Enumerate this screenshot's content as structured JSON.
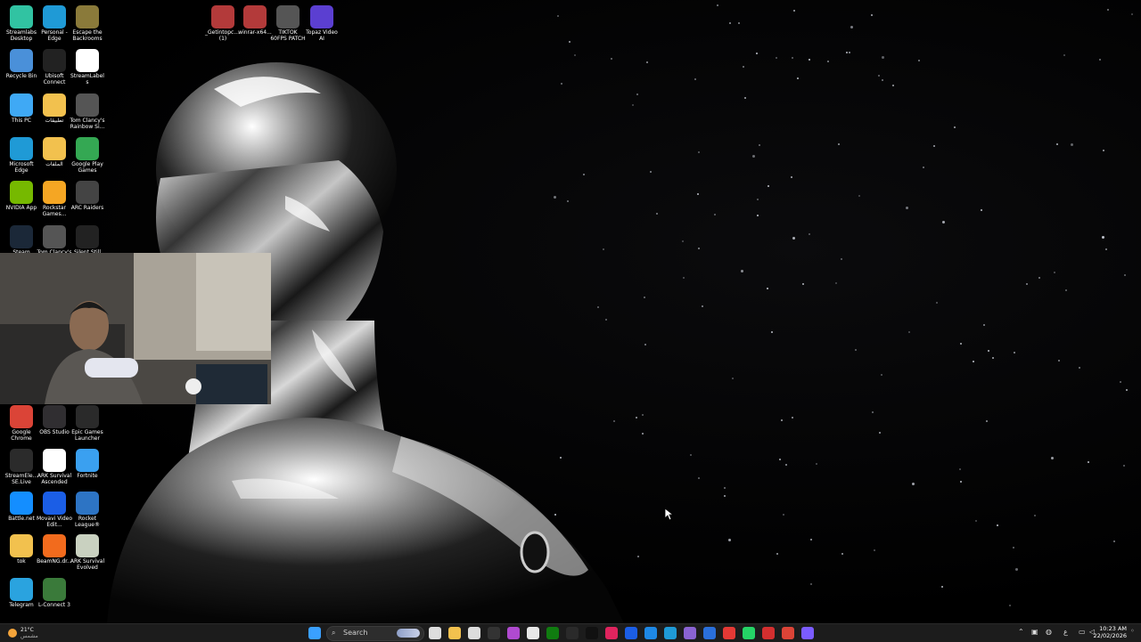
{
  "desktop_icons": [
    {
      "label": "Streamlabs Desktop",
      "icon": "streamlabs-icon",
      "color": "#31c3a2"
    },
    {
      "label": "Personal - Edge",
      "icon": "edge-icon",
      "color": "#1f9ad6"
    },
    {
      "label": "Escape the Backrooms",
      "icon": "game-icon",
      "color": "#8a7a3a"
    },
    {
      "label": "Recycle Bin",
      "icon": "recycle-bin-icon",
      "color": "#4a90d9"
    },
    {
      "label": "Ubisoft Connect",
      "icon": "ubisoft-icon",
      "color": "#222222"
    },
    {
      "label": "StreamLabels",
      "icon": "streamlabels-icon",
      "color": "#ffffff"
    },
    {
      "label": "This PC",
      "icon": "this-pc-icon",
      "color": "#3fa9f5"
    },
    {
      "label": "تطبيقات",
      "icon": "folder-icon",
      "color": "#f2c14e"
    },
    {
      "label": "Tom Clancy's Rainbow Si...",
      "icon": "game-icon",
      "color": "#555555"
    },
    {
      "label": "Microsoft Edge",
      "icon": "edge-icon",
      "color": "#1f9ad6"
    },
    {
      "label": "الملفات",
      "icon": "folder-icon",
      "color": "#f2c14e"
    },
    {
      "label": "Google Play Games",
      "icon": "play-games-icon",
      "color": "#34a853"
    },
    {
      "label": "NVIDIA App",
      "icon": "nvidia-icon",
      "color": "#76b900"
    },
    {
      "label": "Rockstar Games...",
      "icon": "rockstar-icon",
      "color": "#f5a623"
    },
    {
      "label": "ARC Raiders",
      "icon": "game-icon",
      "color": "#444444"
    },
    {
      "label": "Steam",
      "icon": "steam-icon",
      "color": "#1b2838"
    },
    {
      "label": "Tom Clancy's",
      "icon": "game-icon",
      "color": "#555555"
    },
    {
      "label": "Silent Still",
      "icon": "game-icon",
      "color": "#222222"
    },
    {
      "label": "Google Chrome",
      "icon": "chrome-icon",
      "color": "#db4437"
    },
    {
      "label": "OBS Studio",
      "icon": "obs-icon",
      "color": "#302e31"
    },
    {
      "label": "Epic Games Launcher",
      "icon": "epic-games-icon",
      "color": "#2a2a2a"
    },
    {
      "label": "StreamEle... SE.Live",
      "icon": "streamelements-icon",
      "color": "#2b2b2b"
    },
    {
      "label": "ARK Survival Ascended",
      "icon": "file-icon",
      "color": "#ffffff"
    },
    {
      "label": "Fortnite",
      "icon": "fortnite-icon",
      "color": "#3aa0f0"
    },
    {
      "label": "Battle.net",
      "icon": "battlenet-icon",
      "color": "#148eff"
    },
    {
      "label": "Movavi Video Edit...",
      "icon": "movavi-icon",
      "color": "#1b5ee6"
    },
    {
      "label": "Rocket League®",
      "icon": "rocket-league-icon",
      "color": "#2d74c4"
    },
    {
      "label": "tok",
      "icon": "folder-icon",
      "color": "#f2c14e"
    },
    {
      "label": "BeamNG.dr...",
      "icon": "beamng-icon",
      "color": "#f26b1d"
    },
    {
      "label": "ARK Survival Evolved",
      "icon": "ark-icon",
      "color": "#c9d1c0"
    },
    {
      "label": "Telegram",
      "icon": "telegram-icon",
      "color": "#2aa3df"
    },
    {
      "label": "L-Connect 3",
      "icon": "l-connect-icon",
      "color": "#3a7a3a"
    },
    {
      "label": "_Getintopc.... (1)",
      "icon": "winrar-icon",
      "color": "#b33a3a"
    },
    {
      "label": "winrar-x64...",
      "icon": "winrar-icon",
      "color": "#b33a3a"
    },
    {
      "label": "TIKTOK 60FPS PATCH",
      "icon": "tiktok-patch-icon",
      "color": "#555555"
    },
    {
      "label": "Topaz Video AI",
      "icon": "topaz-icon",
      "color": "#5b3fd1"
    }
  ],
  "taskbar": {
    "search_label": "Search",
    "weather_temp": "21°C",
    "weather_cond": "مشمس",
    "time": "10:23 AM",
    "date": "22/02/2026",
    "pinned": [
      {
        "icon": "start-icon",
        "color": "#3aa0ff"
      },
      {
        "icon": "task-view-icon",
        "color": "#dddddd"
      },
      {
        "icon": "file-explorer-icon",
        "color": "#f2c14e"
      },
      {
        "icon": "notepad-icon",
        "color": "#dddddd"
      },
      {
        "icon": "app-icon",
        "color": "#333333"
      },
      {
        "icon": "app-icon",
        "color": "#b04ad0"
      },
      {
        "icon": "store-icon",
        "color": "#e8e8e8"
      },
      {
        "icon": "xbox-icon",
        "color": "#107c10"
      },
      {
        "icon": "steam-icon",
        "color": "#2a2a2a"
      },
      {
        "icon": "tiktok-icon",
        "color": "#111111"
      },
      {
        "icon": "app-icon",
        "color": "#e0245e"
      },
      {
        "icon": "app-icon",
        "color": "#1b5ee6"
      },
      {
        "icon": "app-icon",
        "color": "#1e88e5"
      },
      {
        "icon": "edge-icon",
        "color": "#1f9ad6"
      },
      {
        "icon": "app-icon",
        "color": "#8a63d2"
      },
      {
        "icon": "app-icon",
        "color": "#2a6fdb"
      },
      {
        "icon": "app-icon",
        "color": "#e53935"
      },
      {
        "icon": "whatsapp-icon",
        "color": "#25d366"
      },
      {
        "icon": "app-icon",
        "color": "#d32f2f"
      },
      {
        "icon": "chrome-icon",
        "color": "#db4437"
      },
      {
        "icon": "app-icon",
        "color": "#7b5cff"
      }
    ]
  }
}
